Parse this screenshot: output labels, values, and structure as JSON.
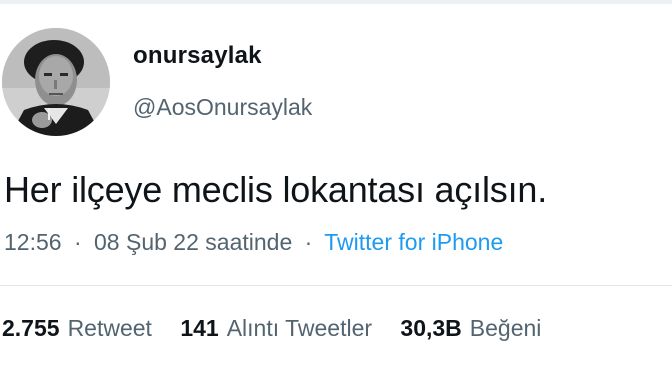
{
  "author": {
    "display_name": "onursaylak",
    "handle": "@AosOnursaylak",
    "avatar_icon": "profile-photo"
  },
  "tweet": {
    "text": "Her ilçeye meclis lokantası açılsın."
  },
  "meta": {
    "time": "12:56",
    "date": "08 Şub 22 saatinde",
    "separator": "·",
    "source": "Twitter for iPhone"
  },
  "stats": {
    "retweets": {
      "count": "2.755",
      "label": "Retweet"
    },
    "quotes": {
      "count": "141",
      "label": "Alıntı Tweetler"
    },
    "likes": {
      "count": "30,3B",
      "label": "Beğeni"
    }
  },
  "colors": {
    "text": "#0f1419",
    "secondary": "#536471",
    "link": "#1d9bf0",
    "divider": "#e3e7ea"
  }
}
